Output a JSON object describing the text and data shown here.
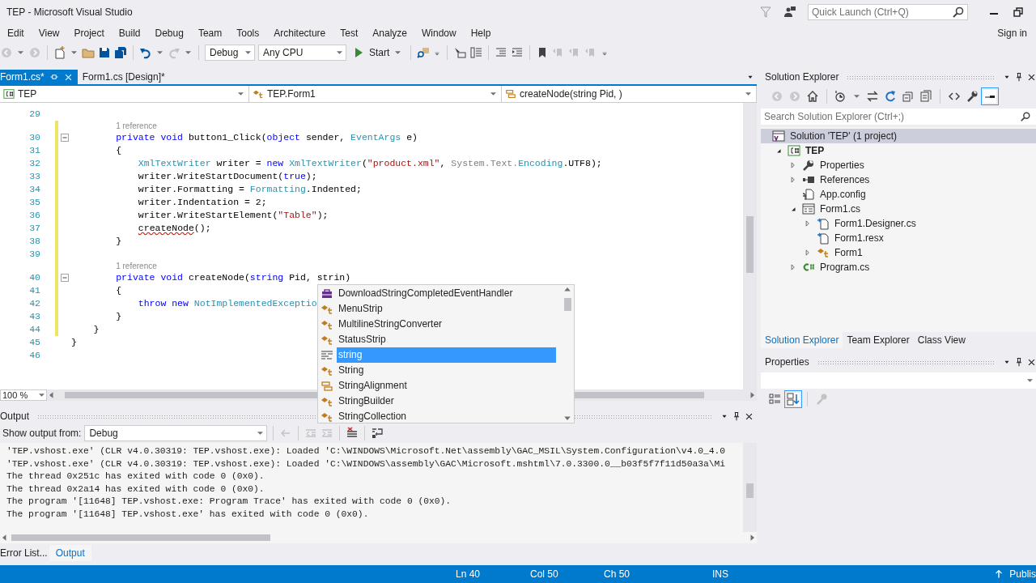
{
  "window": {
    "title": "TEP - Microsoft Visual Studio",
    "quick_launch": {
      "placeholder": "Quick Launch (Ctrl+Q)"
    },
    "sign_in": "Sign in"
  },
  "menu": [
    "Edit",
    "View",
    "Project",
    "Build",
    "Debug",
    "Team",
    "Tools",
    "Architecture",
    "Test",
    "Analyze",
    "Window",
    "Help"
  ],
  "toolbar": {
    "configuration": "Debug",
    "platform": "Any CPU",
    "start": "Start"
  },
  "editor": {
    "tabs": [
      {
        "label": "Form1.cs*",
        "selected": true
      },
      {
        "label": "Form1.cs [Design]*",
        "selected": false
      }
    ],
    "nav": [
      "TEP",
      "TEP.Form1",
      "createNode(string Pid, )"
    ],
    "lines": [
      {
        "number": "29",
        "changed": false,
        "foldable": false
      },
      {
        "number": "30",
        "changed": true,
        "foldable": true,
        "lens": "1 reference",
        "tokens": [
          {
            "kind": "kw",
            "text": "        private void"
          },
          {
            "kind": "plain",
            "text": " button1_Click("
          },
          {
            "kind": "kw",
            "text": "object"
          },
          {
            "kind": "plain",
            "text": " sender, "
          },
          {
            "kind": "type",
            "text": "EventArgs"
          },
          {
            "kind": "plain",
            "text": " e)"
          }
        ]
      },
      {
        "number": "31",
        "changed": true,
        "foldable": false,
        "tokens": [
          {
            "kind": "plain",
            "text": "        {"
          }
        ]
      },
      {
        "number": "32",
        "changed": true,
        "foldable": false,
        "tokens": [
          {
            "kind": "type",
            "text": "            XmlTextWriter"
          },
          {
            "kind": "plain",
            "text": " writer = "
          },
          {
            "kind": "kw",
            "text": "new"
          },
          {
            "kind": "type",
            "text": " XmlTextWriter"
          },
          {
            "kind": "plain",
            "text": "("
          },
          {
            "kind": "str",
            "text": "\"product.xml\""
          },
          {
            "kind": "plain",
            "text": ", "
          },
          {
            "kind": "dim",
            "text": "System.Text."
          },
          {
            "kind": "type",
            "text": "Encoding"
          },
          {
            "kind": "plain",
            "text": ".UTF8);"
          }
        ]
      },
      {
        "number": "33",
        "changed": true,
        "foldable": false,
        "tokens": [
          {
            "kind": "plain",
            "text": "            writer.WriteStartDocument("
          },
          {
            "kind": "kw",
            "text": "true"
          },
          {
            "kind": "plain",
            "text": ");"
          }
        ]
      },
      {
        "number": "34",
        "changed": true,
        "foldable": false,
        "tokens": [
          {
            "kind": "plain",
            "text": "            writer.Formatting = "
          },
          {
            "kind": "type",
            "text": "Formatting"
          },
          {
            "kind": "plain",
            "text": ".Indented;"
          }
        ]
      },
      {
        "number": "35",
        "changed": true,
        "foldable": false,
        "tokens": [
          {
            "kind": "plain",
            "text": "            writer.Indentation = 2;"
          }
        ]
      },
      {
        "number": "36",
        "changed": true,
        "foldable": false,
        "tokens": [
          {
            "kind": "plain",
            "text": "            writer.WriteStartElement("
          },
          {
            "kind": "str",
            "text": "\"Table\""
          },
          {
            "kind": "plain",
            "text": ");"
          }
        ]
      },
      {
        "number": "37",
        "changed": true,
        "foldable": false,
        "tokens": [
          {
            "kind": "err",
            "text": "            createNode"
          },
          {
            "kind": "plain",
            "text": "();"
          }
        ]
      },
      {
        "number": "38",
        "changed": true,
        "foldable": false,
        "tokens": [
          {
            "kind": "plain",
            "text": "        }"
          }
        ]
      },
      {
        "number": "39",
        "changed": true,
        "foldable": false
      },
      {
        "number": "40",
        "changed": true,
        "foldable": true,
        "lens": "1 reference",
        "tokens": [
          {
            "kind": "kw",
            "text": "        private void"
          },
          {
            "kind": "plain",
            "text": " createNode("
          },
          {
            "kind": "kw",
            "text": "string"
          },
          {
            "kind": "plain",
            "text": " Pid, strin)"
          }
        ]
      },
      {
        "number": "41",
        "changed": true,
        "foldable": false,
        "tokens": [
          {
            "kind": "plain",
            "text": "        {"
          }
        ]
      },
      {
        "number": "42",
        "changed": true,
        "foldable": false,
        "tokens": [
          {
            "kind": "kw",
            "text": "            throw new"
          },
          {
            "kind": "type",
            "text": " NotImplementedExceptio"
          }
        ]
      },
      {
        "number": "43",
        "changed": true,
        "foldable": false,
        "tokens": [
          {
            "kind": "plain",
            "text": "        }"
          }
        ]
      },
      {
        "number": "44",
        "changed": true,
        "foldable": false,
        "tokens": [
          {
            "kind": "plain",
            "text": "    }"
          }
        ]
      },
      {
        "number": "45",
        "changed": false,
        "foldable": false,
        "tokens": [
          {
            "kind": "plain",
            "text": "}"
          }
        ]
      },
      {
        "number": "46",
        "changed": false,
        "foldable": false
      }
    ],
    "zoom": "100 %"
  },
  "completion": {
    "items": [
      {
        "label": "DownloadStringCompletedEventHandler",
        "kind": "delegate",
        "selected": false
      },
      {
        "label": "MenuStrip",
        "kind": "class",
        "selected": false
      },
      {
        "label": "MultilineStringConverter",
        "kind": "class",
        "selected": false
      },
      {
        "label": "StatusStrip",
        "kind": "class",
        "selected": false
      },
      {
        "label": "string",
        "kind": "keyword",
        "selected": true
      },
      {
        "label": "String",
        "kind": "class",
        "selected": false
      },
      {
        "label": "StringAlignment",
        "kind": "enum",
        "selected": false
      },
      {
        "label": "StringBuilder",
        "kind": "class",
        "selected": false
      },
      {
        "label": "StringCollection",
        "kind": "class",
        "selected": false
      }
    ]
  },
  "output": {
    "title": "Output",
    "source_label": "Show output from:",
    "source": "Debug",
    "lines": [
      "'TEP.vshost.exe' (CLR v4.0.30319: TEP.vshost.exe): Loaded 'C:\\WINDOWS\\Microsoft.Net\\assembly\\GAC_MSIL\\System.Configuration\\v4.0_4.0",
      "'TEP.vshost.exe' (CLR v4.0.30319: TEP.vshost.exe): Loaded 'C:\\WINDOWS\\assembly\\GAC\\Microsoft.mshtml\\7.0.3300.0__b03f5f7f11d50a3a\\Mi",
      "The thread 0x251c has exited with code 0 (0x0).",
      "The thread 0x2a14 has exited with code 0 (0x0).",
      "The program '[11648] TEP.vshost.exe: Program Trace' has exited with code 0 (0x0).",
      "The program '[11648] TEP.vshost.exe' has exited with code 0 (0x0)."
    ]
  },
  "bottom_tabs": [
    {
      "label": "Error List...",
      "selected": false
    },
    {
      "label": "Output",
      "selected": true
    }
  ],
  "status_bar": {
    "items": [
      "Ln 40",
      "Col 50",
      "Ch 50",
      "INS"
    ],
    "publish": "Publis"
  },
  "solution_explorer": {
    "title": "Solution Explorer",
    "search": {
      "placeholder": "Search Solution Explorer (Ctrl+;)"
    },
    "tree": [
      {
        "label": "Solution 'TEP' (1 project)",
        "kind": "solution",
        "selected": true,
        "children": [
          {
            "label": "TEP",
            "kind": "project",
            "selected": false,
            "expanded": true,
            "children": [
              {
                "label": "Properties",
                "kind": "properties",
                "selected": false,
                "expanded": false
              },
              {
                "label": "References",
                "kind": "references",
                "selected": false,
                "expanded": false
              },
              {
                "label": "App.config",
                "kind": "config",
                "selected": false
              },
              {
                "label": "Form1.cs",
                "kind": "form",
                "selected": false,
                "expanded": true,
                "children": [
                  {
                    "label": "Form1.Designer.cs",
                    "kind": "file",
                    "selected": false,
                    "expanded": false
                  },
                  {
                    "label": "Form1.resx",
                    "kind": "file",
                    "selected": false
                  },
                  {
                    "label": "Form1",
                    "kind": "class",
                    "selected": false,
                    "expanded": false
                  }
                ]
              },
              {
                "label": "Program.cs",
                "kind": "csharp",
                "selected": false,
                "expanded": false
              }
            ]
          }
        ]
      }
    ],
    "tabs": [
      {
        "label": "Solution Explorer",
        "selected": true
      },
      {
        "label": "Team Explorer",
        "selected": false
      },
      {
        "label": "Class View",
        "selected": false
      }
    ]
  },
  "properties": {
    "title": "Properties"
  }
}
